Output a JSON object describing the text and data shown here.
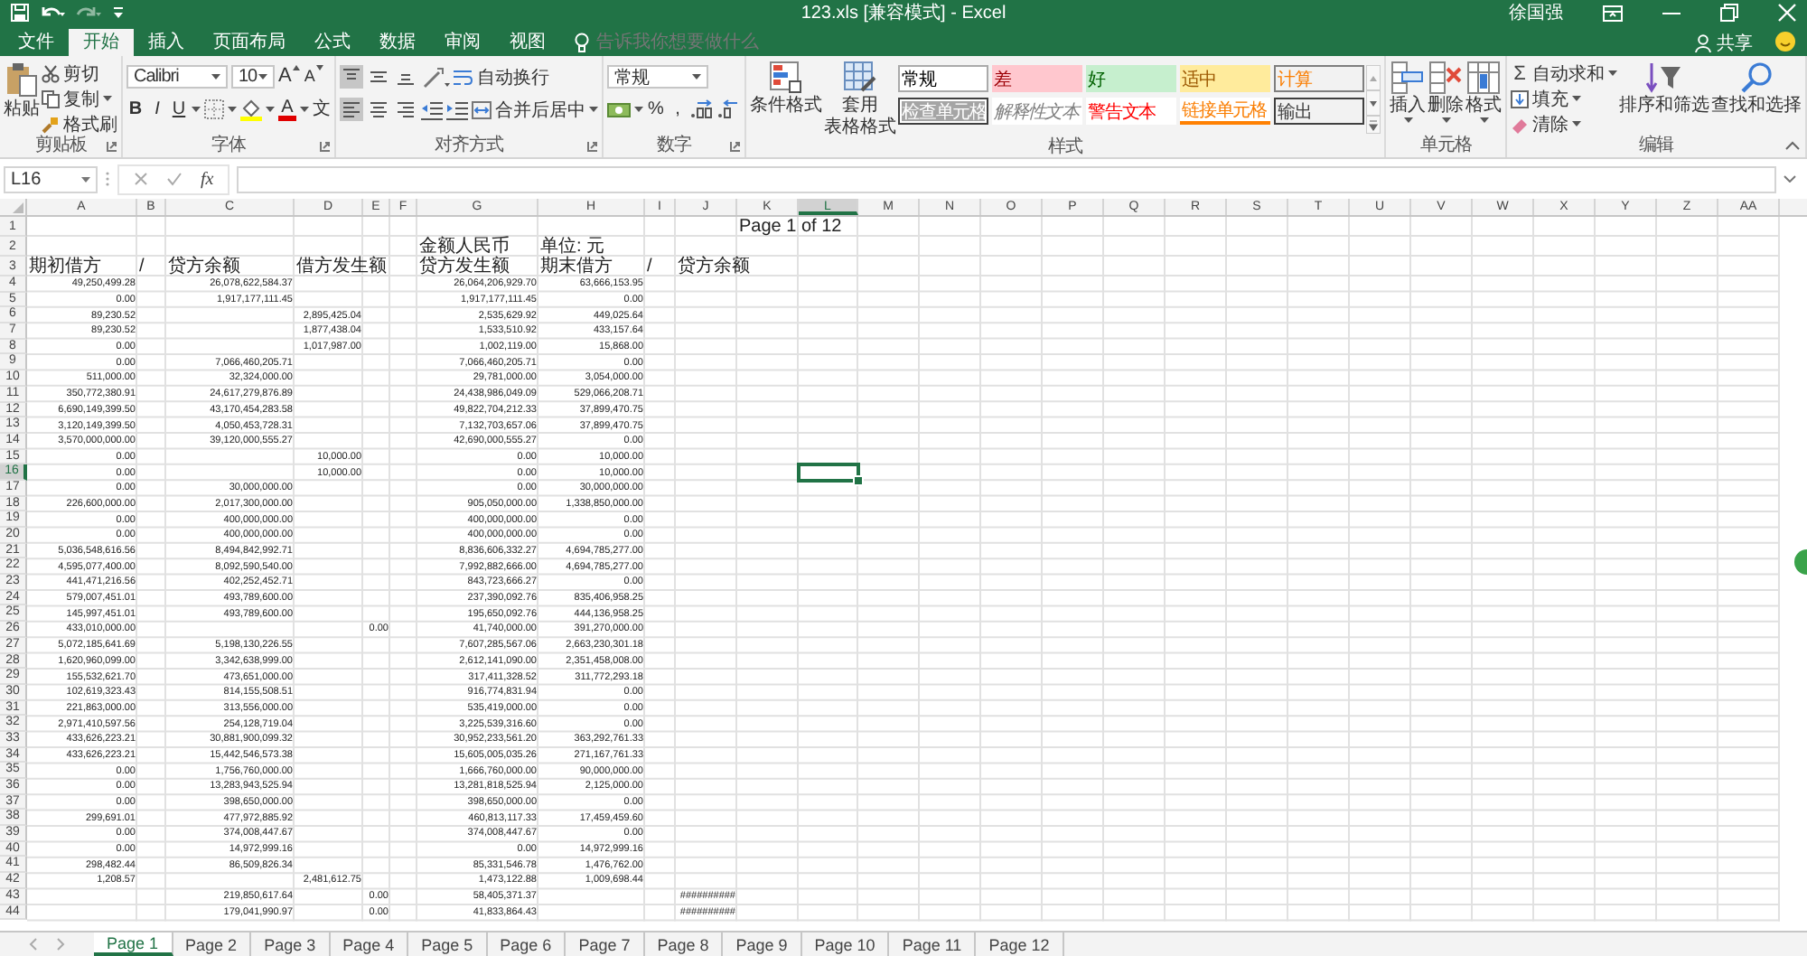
{
  "window": {
    "title": "123.xls [兼容模式] - Excel",
    "user": "徐国强"
  },
  "ribbon_tabs": [
    {
      "label": "文件",
      "selected": false
    },
    {
      "label": "开始",
      "selected": true
    },
    {
      "label": "插入",
      "selected": false
    },
    {
      "label": "页面布局",
      "selected": false
    },
    {
      "label": "公式",
      "selected": false
    },
    {
      "label": "数据",
      "selected": false
    },
    {
      "label": "审阅",
      "selected": false
    },
    {
      "label": "视图",
      "selected": false
    }
  ],
  "tell_me": {
    "placeholder": "告诉我你想要做什么"
  },
  "share": {
    "label": "共享"
  },
  "ribbon": {
    "clipboard": {
      "paste": "粘贴",
      "cut": "剪切",
      "copy": "复制",
      "format_painter": "格式刷",
      "label": "剪贴板"
    },
    "font": {
      "name": "Calibri",
      "size": "10",
      "grow": "A",
      "shrink": "A",
      "bold": "B",
      "italic": "I",
      "underline": "U",
      "font_color": "A",
      "phonetic": "文",
      "label": "字体"
    },
    "alignment": {
      "vertical": [
        {
          "kind": "top",
          "selected": true
        },
        {
          "kind": "middle",
          "selected": false
        },
        {
          "kind": "bottom",
          "selected": false
        }
      ],
      "horizontal": [
        {
          "kind": "left",
          "selected": true
        },
        {
          "kind": "center",
          "selected": false
        },
        {
          "kind": "right",
          "selected": false
        }
      ],
      "wrap_text": "自动换行",
      "merge_center": "合并后居中",
      "label": "对齐方式"
    },
    "number": {
      "format": "常规",
      "percent": "%",
      "comma": ",",
      "label": "数字"
    },
    "styles": {
      "conditional": "条件格式",
      "table_format": {
        "line_1": "套用",
        "line_2": "表格格式"
      },
      "label": "样式",
      "gallery": [
        {
          "label": "常规",
          "kind": "normal"
        },
        {
          "label": "差",
          "kind": "bad"
        },
        {
          "label": "好",
          "kind": "good"
        },
        {
          "label": "适中",
          "kind": "neutral"
        },
        {
          "label": "计算",
          "kind": "calculation"
        },
        {
          "label": "检查单元格",
          "kind": "check"
        },
        {
          "label": "解释性文本",
          "kind": "explanatory"
        },
        {
          "label": "警告文本",
          "kind": "warning"
        },
        {
          "label": "链接单元格",
          "kind": "linked"
        },
        {
          "label": "输出",
          "kind": "output"
        }
      ]
    },
    "cells": {
      "label": "单元格",
      "buttons": [
        {
          "label": "插入",
          "kind": "insert"
        },
        {
          "label": "删除",
          "kind": "delete"
        },
        {
          "label": "格式",
          "kind": "format"
        }
      ]
    },
    "editing": {
      "autosum_glyph": "Σ",
      "autosum": "自动求和",
      "fill": "填充",
      "clear": "清除",
      "sort_filter": "排序和筛选",
      "find_select": "查找和选择",
      "label": "编辑"
    }
  },
  "formula_bar": {
    "name_box": "L16",
    "function_label": "fx"
  },
  "sheet": {
    "columns": [
      {
        "label": "A",
        "selected": false
      },
      {
        "label": "B",
        "selected": false
      },
      {
        "label": "C",
        "selected": false
      },
      {
        "label": "D",
        "selected": false
      },
      {
        "label": "E",
        "selected": false
      },
      {
        "label": "F",
        "selected": false
      },
      {
        "label": "G",
        "selected": false
      },
      {
        "label": "H",
        "selected": false
      },
      {
        "label": "I",
        "selected": false
      },
      {
        "label": "J",
        "selected": false
      },
      {
        "label": "K",
        "selected": false
      },
      {
        "label": "L",
        "selected": true
      },
      {
        "label": "M",
        "selected": false
      },
      {
        "label": "N",
        "selected": false
      },
      {
        "label": "O",
        "selected": false
      },
      {
        "label": "P",
        "selected": false
      },
      {
        "label": "Q",
        "selected": false
      },
      {
        "label": "R",
        "selected": false
      },
      {
        "label": "S",
        "selected": false
      },
      {
        "label": "T",
        "selected": false
      },
      {
        "label": "U",
        "selected": false
      },
      {
        "label": "V",
        "selected": false
      },
      {
        "label": "W",
        "selected": false
      },
      {
        "label": "X",
        "selected": false
      },
      {
        "label": "Y",
        "selected": false
      },
      {
        "label": "Z",
        "selected": false
      },
      {
        "label": "AA",
        "selected": false
      }
    ],
    "rows": [
      {
        "number": "1",
        "kind": "label",
        "selected": false,
        "cells": {
          "K": "Page 1 of 12"
        }
      },
      {
        "number": "2",
        "kind": "label",
        "selected": false,
        "cells": {
          "G": "金额人民币",
          "H": "单位: 元"
        }
      },
      {
        "number": "3",
        "kind": "label",
        "selected": false,
        "cells": {
          "A": "期初借方",
          "B": "/",
          "C": "贷方余额",
          "D": "借方发生额",
          "G": "贷方发生额",
          "H": "期末借方",
          "I": "/",
          "J": "贷方余额"
        }
      },
      {
        "number": "4",
        "kind": "data",
        "selected": false,
        "cells": {
          "A": "49,250,499.28",
          "C": "26,078,622,584.37",
          "G": "26,064,206,929.70",
          "H": "63,666,153.95"
        }
      },
      {
        "number": "5",
        "kind": "data",
        "selected": false,
        "cells": {
          "A": "0.00",
          "C": "1,917,177,111.45",
          "G": "1,917,177,111.45",
          "H": "0.00"
        }
      },
      {
        "number": "6",
        "kind": "data",
        "selected": false,
        "cells": {
          "A": "89,230.52",
          "D": "2,895,425.04",
          "G": "2,535,629.92",
          "H": "449,025.64"
        }
      },
      {
        "number": "7",
        "kind": "data",
        "selected": false,
        "cells": {
          "A": "89,230.52",
          "D": "1,877,438.04",
          "G": "1,533,510.92",
          "H": "433,157.64"
        }
      },
      {
        "number": "8",
        "kind": "data",
        "selected": false,
        "cells": {
          "A": "0.00",
          "D": "1,017,987.00",
          "G": "1,002,119.00",
          "H": "15,868.00"
        }
      },
      {
        "number": "9",
        "kind": "data",
        "selected": false,
        "cells": {
          "A": "0.00",
          "C": "7,066,460,205.71",
          "G": "7,066,460,205.71",
          "H": "0.00"
        }
      },
      {
        "number": "10",
        "kind": "data",
        "selected": false,
        "cells": {
          "A": "511,000.00",
          "C": "32,324,000.00",
          "G": "29,781,000.00",
          "H": "3,054,000.00"
        }
      },
      {
        "number": "11",
        "kind": "data",
        "selected": false,
        "cells": {
          "A": "350,772,380.91",
          "C": "24,617,279,876.89",
          "G": "24,438,986,049.09",
          "H": "529,066,208.71"
        }
      },
      {
        "number": "12",
        "kind": "data",
        "selected": false,
        "cells": {
          "A": "6,690,149,399.50",
          "C": "43,170,454,283.58",
          "G": "49,822,704,212.33",
          "H": "37,899,470.75"
        }
      },
      {
        "number": "13",
        "kind": "data",
        "selected": false,
        "cells": {
          "A": "3,120,149,399.50",
          "C": "4,050,453,728.31",
          "G": "7,132,703,657.06",
          "H": "37,899,470.75"
        }
      },
      {
        "number": "14",
        "kind": "data",
        "selected": false,
        "cells": {
          "A": "3,570,000,000.00",
          "C": "39,120,000,555.27",
          "G": "42,690,000,555.27",
          "H": "0.00"
        }
      },
      {
        "number": "15",
        "kind": "data",
        "selected": false,
        "cells": {
          "A": "0.00",
          "D": "10,000.00",
          "G": "0.00",
          "H": "10,000.00"
        }
      },
      {
        "number": "16",
        "kind": "data",
        "selected": true,
        "cells": {
          "A": "0.00",
          "D": "10,000.00",
          "G": "0.00",
          "H": "10,000.00"
        }
      },
      {
        "number": "17",
        "kind": "data",
        "selected": false,
        "cells": {
          "A": "0.00",
          "C": "30,000,000.00",
          "G": "0.00",
          "H": "30,000,000.00"
        }
      },
      {
        "number": "18",
        "kind": "data",
        "selected": false,
        "cells": {
          "A": "226,600,000.00",
          "C": "2,017,300,000.00",
          "G": "905,050,000.00",
          "H": "1,338,850,000.00"
        }
      },
      {
        "number": "19",
        "kind": "data",
        "selected": false,
        "cells": {
          "A": "0.00",
          "C": "400,000,000.00",
          "G": "400,000,000.00",
          "H": "0.00"
        }
      },
      {
        "number": "20",
        "kind": "data",
        "selected": false,
        "cells": {
          "A": "0.00",
          "C": "400,000,000.00",
          "G": "400,000,000.00",
          "H": "0.00"
        }
      },
      {
        "number": "21",
        "kind": "data",
        "selected": false,
        "cells": {
          "A": "5,036,548,616.56",
          "C": "8,494,842,992.71",
          "G": "8,836,606,332.27",
          "H": "4,694,785,277.00"
        }
      },
      {
        "number": "22",
        "kind": "data",
        "selected": false,
        "cells": {
          "A": "4,595,077,400.00",
          "C": "8,092,590,540.00",
          "G": "7,992,882,666.00",
          "H": "4,694,785,277.00"
        }
      },
      {
        "number": "23",
        "kind": "data",
        "selected": false,
        "cells": {
          "A": "441,471,216.56",
          "C": "402,252,452.71",
          "G": "843,723,666.27",
          "H": "0.00"
        }
      },
      {
        "number": "24",
        "kind": "data",
        "selected": false,
        "cells": {
          "A": "579,007,451.01",
          "C": "493,789,600.00",
          "G": "237,390,092.76",
          "H": "835,406,958.25"
        }
      },
      {
        "number": "25",
        "kind": "data",
        "selected": false,
        "cells": {
          "A": "145,997,451.01",
          "C": "493,789,600.00",
          "G": "195,650,092.76",
          "H": "444,136,958.25"
        }
      },
      {
        "number": "26",
        "kind": "data",
        "selected": false,
        "cells": {
          "A": "433,010,000.00",
          "E": "0.00",
          "G": "41,740,000.00",
          "H": "391,270,000.00"
        }
      },
      {
        "number": "27",
        "kind": "data",
        "selected": false,
        "cells": {
          "A": "5,072,185,641.69",
          "C": "5,198,130,226.55",
          "G": "7,607,285,567.06",
          "H": "2,663,230,301.18"
        }
      },
      {
        "number": "28",
        "kind": "data",
        "selected": false,
        "cells": {
          "A": "1,620,960,099.00",
          "C": "3,342,638,999.00",
          "G": "2,612,141,090.00",
          "H": "2,351,458,008.00"
        }
      },
      {
        "number": "29",
        "kind": "data",
        "selected": false,
        "cells": {
          "A": "155,532,621.70",
          "C": "473,651,000.00",
          "G": "317,411,328.52",
          "H": "311,772,293.18"
        }
      },
      {
        "number": "30",
        "kind": "data",
        "selected": false,
        "cells": {
          "A": "102,619,323.43",
          "C": "814,155,508.51",
          "G": "916,774,831.94",
          "H": "0.00"
        }
      },
      {
        "number": "31",
        "kind": "data",
        "selected": false,
        "cells": {
          "A": "221,863,000.00",
          "C": "313,556,000.00",
          "G": "535,419,000.00",
          "H": "0.00"
        }
      },
      {
        "number": "32",
        "kind": "data",
        "selected": false,
        "cells": {
          "A": "2,971,410,597.56",
          "C": "254,128,719.04",
          "G": "3,225,539,316.60",
          "H": "0.00"
        }
      },
      {
        "number": "33",
        "kind": "data",
        "selected": false,
        "cells": {
          "A": "433,626,223.21",
          "C": "30,881,900,099.32",
          "G": "30,952,233,561.20",
          "H": "363,292,761.33"
        }
      },
      {
        "number": "34",
        "kind": "data",
        "selected": false,
        "cells": {
          "A": "433,626,223.21",
          "C": "15,442,546,573.38",
          "G": "15,605,005,035.26",
          "H": "271,167,761.33"
        }
      },
      {
        "number": "35",
        "kind": "data",
        "selected": false,
        "cells": {
          "A": "0.00",
          "C": "1,756,760,000.00",
          "G": "1,666,760,000.00",
          "H": "90,000,000.00"
        }
      },
      {
        "number": "36",
        "kind": "data",
        "selected": false,
        "cells": {
          "A": "0.00",
          "C": "13,283,943,525.94",
          "G": "13,281,818,525.94",
          "H": "2,125,000.00"
        }
      },
      {
        "number": "37",
        "kind": "data",
        "selected": false,
        "cells": {
          "A": "0.00",
          "C": "398,650,000.00",
          "G": "398,650,000.00",
          "H": "0.00"
        }
      },
      {
        "number": "38",
        "kind": "data",
        "selected": false,
        "cells": {
          "A": "299,691.01",
          "C": "477,972,885.92",
          "G": "460,813,117.33",
          "H": "17,459,459.60"
        }
      },
      {
        "number": "39",
        "kind": "data",
        "selected": false,
        "cells": {
          "A": "0.00",
          "C": "374,008,447.67",
          "G": "374,008,447.67",
          "H": "0.00"
        }
      },
      {
        "number": "40",
        "kind": "data",
        "selected": false,
        "cells": {
          "A": "0.00",
          "C": "14,972,999.16",
          "G": "0.00",
          "H": "14,972,999.16"
        }
      },
      {
        "number": "41",
        "kind": "data",
        "selected": false,
        "cells": {
          "A": "298,482.44",
          "C": "86,509,826.34",
          "G": "85,331,546.78",
          "H": "1,476,762.00"
        }
      },
      {
        "number": "42",
        "kind": "data",
        "selected": false,
        "cells": {
          "A": "1,208.57",
          "D": "2,481,612.75",
          "G": "1,473,122.88",
          "H": "1,009,698.44"
        }
      },
      {
        "number": "43",
        "kind": "data",
        "selected": false,
        "cells": {
          "C": "219,850,617.64",
          "E": "0.00",
          "G": "58,405,371.37",
          "J": "##########"
        }
      },
      {
        "number": "44",
        "kind": "data",
        "selected": false,
        "cells": {
          "C": "179,041,990.97",
          "E": "0.00",
          "G": "41,833,864.43",
          "J": "##########"
        }
      }
    ]
  },
  "sheet_tabs": [
    {
      "label": "Page 1",
      "selected": true
    },
    {
      "label": "Page 2",
      "selected": false
    },
    {
      "label": "Page 3",
      "selected": false
    },
    {
      "label": "Page 4",
      "selected": false
    },
    {
      "label": "Page 5",
      "selected": false
    },
    {
      "label": "Page 6",
      "selected": false
    },
    {
      "label": "Page 7",
      "selected": false
    },
    {
      "label": "Page 8",
      "selected": false
    },
    {
      "label": "Page 9",
      "selected": false
    },
    {
      "label": "Page 10",
      "selected": false
    },
    {
      "label": "Page 11",
      "selected": false
    },
    {
      "label": "Page 12",
      "selected": false
    }
  ]
}
